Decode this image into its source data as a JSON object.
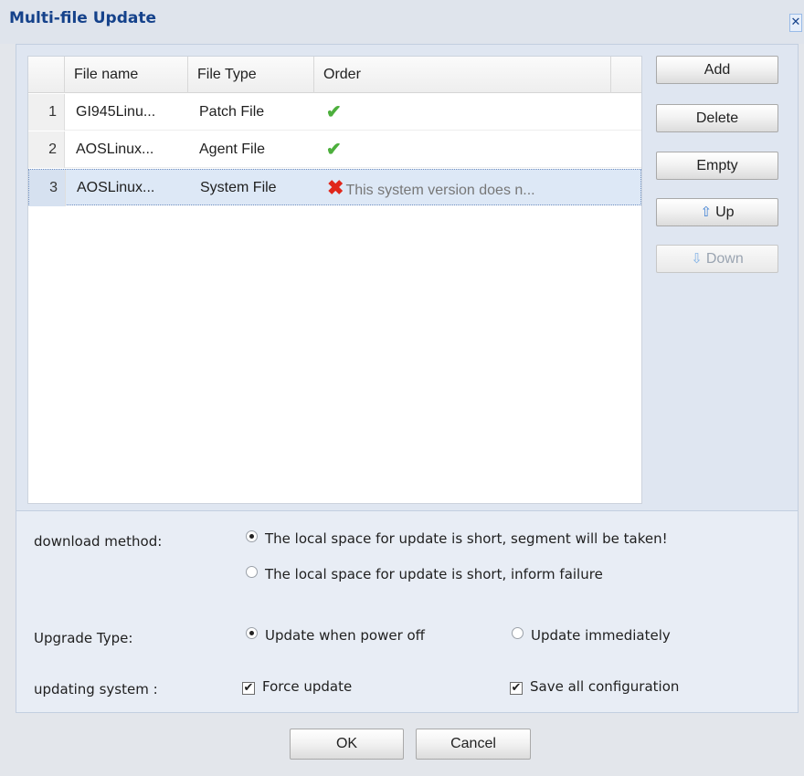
{
  "dialog": {
    "title": "Multi-file Update",
    "close_glyph": "✕"
  },
  "grid": {
    "columns": [
      "File name",
      "File Type",
      "Order"
    ],
    "rows": [
      {
        "num": "1",
        "file_name": "GI945Linu...",
        "file_type": "Patch File",
        "order_status": "ok",
        "order_icon": "✔",
        "order_text": ""
      },
      {
        "num": "2",
        "file_name": "AOSLinux...",
        "file_type": "Agent File",
        "order_status": "ok",
        "order_icon": "✔",
        "order_text": ""
      },
      {
        "num": "3",
        "file_name": "AOSLinux...",
        "file_type": "System File",
        "order_status": "error",
        "order_icon": "✖",
        "order_text": "This system version does n..."
      }
    ],
    "selected_row": "3"
  },
  "side_buttons": {
    "add": "Add",
    "delete": "Delete",
    "empty": "Empty",
    "up": "Up",
    "up_icon": "⇧",
    "down": "Down",
    "down_icon": "⇩"
  },
  "options": {
    "download_method_label": "download method:",
    "download_option_1": "The local space for update is short, segment will be taken!",
    "download_option_2": "The local space for update is short, inform failure",
    "download_selected": "option_1",
    "upgrade_type_label": "Upgrade Type:",
    "upgrade_option_1": "Update when power off",
    "upgrade_option_2": "Update immediately",
    "upgrade_selected": "option_1",
    "updating_system_label": "updating system :",
    "force_update_label": "Force update",
    "force_update_checked": true,
    "save_config_label": "Save all configuration",
    "save_config_checked": true,
    "check_glyph": "✔"
  },
  "footer": {
    "ok": "OK",
    "cancel": "Cancel"
  },
  "colors": {
    "title": "#15428b",
    "check": "#4caf3c",
    "error": "#e0261b",
    "selected_row": "#dde8f6"
  }
}
